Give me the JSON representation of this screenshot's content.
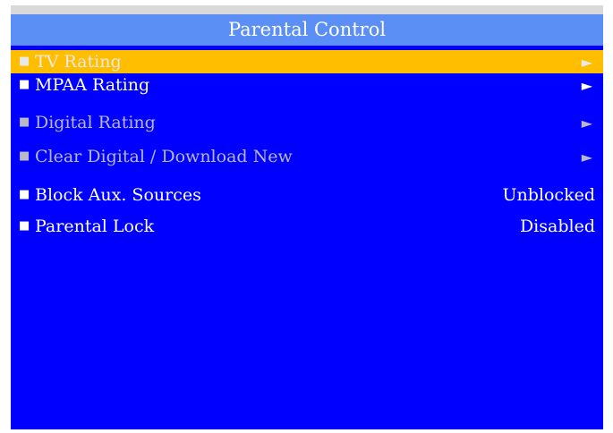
{
  "header": {
    "title": "Parental Control"
  },
  "menu": {
    "items": [
      {
        "bullet": "■",
        "label": "TV Rating",
        "arrow": "►",
        "state": "selected"
      },
      {
        "bullet": "■",
        "label": "MPAA Rating",
        "arrow": "►",
        "state": "normal"
      },
      {
        "bullet": "■",
        "label": "Digital Rating",
        "arrow": "►",
        "state": "disabled"
      },
      {
        "bullet": "■",
        "label": "Clear Digital / Download New",
        "arrow": "►",
        "state": "disabled"
      },
      {
        "bullet": "■",
        "label": "Block Aux. Sources",
        "value": "Unblocked",
        "state": "normal"
      },
      {
        "bullet": "■",
        "label": "Parental Lock",
        "value": "Disabled",
        "state": "normal"
      }
    ]
  },
  "colors": {
    "background": "#0000ff",
    "header": "#5b8ff5",
    "highlight": "#ffbf00",
    "top_strip": "#d9d9d9",
    "text": "#ffffff",
    "disabled_text": "#b8b8c8"
  },
  "icons": {
    "bullet": "square-bullet-icon",
    "arrow": "right-arrow-icon"
  }
}
